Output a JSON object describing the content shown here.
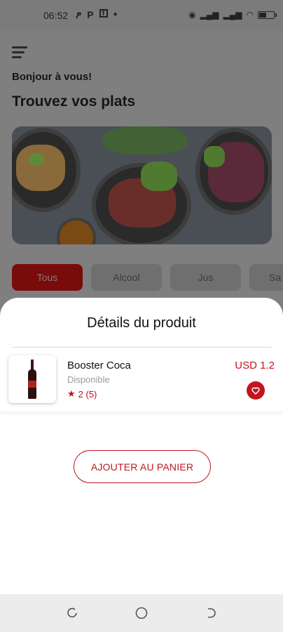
{
  "status_bar": {
    "time": "06:52",
    "left_icons": [
      "chat-icon",
      "parking-icon",
      "facebook-icon",
      "dot-icon"
    ],
    "right_icons": [
      "hotspot-icon",
      "signal-icon",
      "signal-icon",
      "wifi-icon",
      "battery-icon"
    ],
    "battery_level": 0.5
  },
  "header": {
    "menu_icon": "hamburger-menu-icon",
    "greeting": "Bonjour à vous!",
    "headline": "Trouvez vos plats"
  },
  "categories": [
    {
      "label": "Tous",
      "active": true
    },
    {
      "label": "Alcool",
      "active": false
    },
    {
      "label": "Jus",
      "active": false
    },
    {
      "label": "Sa",
      "active": false
    }
  ],
  "sheet": {
    "title": "Détails du produit",
    "product": {
      "name": "Booster Coca",
      "availability": "Disponible",
      "rating": "2 (5)",
      "price": "USD 1.2",
      "favorite_icon": "heart-icon"
    },
    "add_button": "AJOUTER AU PANIER"
  },
  "colors": {
    "accent": "#c0161e",
    "overlay": "#7f7f7f",
    "sheet_bg": "#ffffff"
  },
  "nav_bar": {
    "buttons": [
      "recent-apps-icon",
      "home-icon",
      "back-icon"
    ]
  }
}
